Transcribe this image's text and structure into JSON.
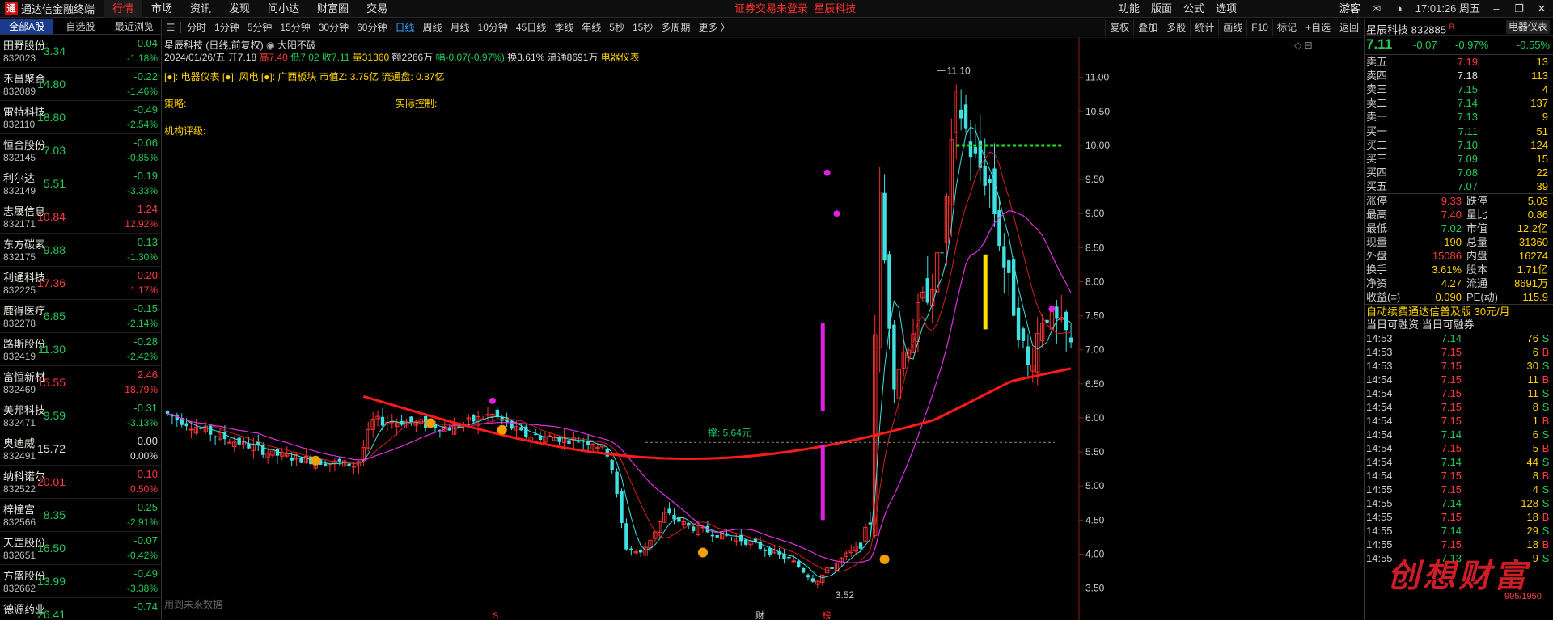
{
  "app": {
    "logo_mark": "通",
    "title": "通达信金融终端",
    "menu": [
      "行情",
      "市场",
      "资讯",
      "发现",
      "问小达",
      "财富圈",
      "交易"
    ],
    "notice": [
      "证券交易未登录",
      "星辰科技"
    ],
    "right_menu": [
      "功能",
      "版面",
      "公式",
      "选项"
    ],
    "user": "游客",
    "time": "17:01:26 周五"
  },
  "left_tabs": [
    "全部A股",
    "自选股",
    "最近浏览"
  ],
  "stocks": [
    {
      "name": "田野股份",
      "code": "832023",
      "price": "3.34",
      "chg": "-0.04",
      "pct": "-1.18%",
      "dir": "dn"
    },
    {
      "name": "禾昌聚合",
      "code": "832089",
      "price": "14.80",
      "chg": "-0.22",
      "pct": "-1.46%",
      "dir": "dn"
    },
    {
      "name": "雷特科技",
      "code": "832110",
      "price": "18.80",
      "chg": "-0.49",
      "pct": "-2.54%",
      "dir": "dn"
    },
    {
      "name": "恒合股份",
      "code": "832145",
      "price": "7.03",
      "chg": "-0.06",
      "pct": "-0.85%",
      "dir": "dn"
    },
    {
      "name": "利尔达",
      "code": "832149",
      "price": "5.51",
      "chg": "-0.19",
      "pct": "-3.33%",
      "dir": "dn"
    },
    {
      "name": "志晟信息",
      "code": "832171",
      "price": "10.84",
      "chg": "1.24",
      "pct": "12.92%",
      "dir": "up"
    },
    {
      "name": "东方碳素",
      "code": "832175",
      "price": "9.88",
      "chg": "-0.13",
      "pct": "-1.30%",
      "dir": "dn"
    },
    {
      "name": "利通科技",
      "code": "832225",
      "price": "17.36",
      "chg": "0.20",
      "pct": "1.17%",
      "dir": "up"
    },
    {
      "name": "鹿得医疗",
      "code": "832278",
      "price": "6.85",
      "chg": "-0.15",
      "pct": "-2.14%",
      "dir": "dn"
    },
    {
      "name": "路斯股份",
      "code": "832419",
      "price": "11.30",
      "chg": "-0.28",
      "pct": "-2.42%",
      "dir": "dn"
    },
    {
      "name": "富恒新材",
      "code": "832469",
      "price": "15.55",
      "chg": "2.46",
      "pct": "18.79%",
      "dir": "up"
    },
    {
      "name": "美邦科技",
      "code": "832471",
      "price": "9.59",
      "chg": "-0.31",
      "pct": "-3.13%",
      "dir": "dn"
    },
    {
      "name": "奥迪威",
      "code": "832491",
      "price": "15.72",
      "chg": "0.00",
      "pct": "0.00%",
      "dir": "flat"
    },
    {
      "name": "纳科诺尔",
      "code": "832522",
      "price": "20.01",
      "chg": "0.10",
      "pct": "0.50%",
      "dir": "up"
    },
    {
      "name": "梓橦宫",
      "code": "832566",
      "price": "8.35",
      "chg": "-0.25",
      "pct": "-2.91%",
      "dir": "dn"
    },
    {
      "name": "天罡股份",
      "code": "832651",
      "price": "16.50",
      "chg": "-0.07",
      "pct": "-0.42%",
      "dir": "dn"
    },
    {
      "name": "方盛股份",
      "code": "832662",
      "price": "13.99",
      "chg": "-0.49",
      "pct": "-3.38%",
      "dir": "dn"
    },
    {
      "name": "德源药业",
      "code": "",
      "price": "26.41",
      "chg": "-0.74",
      "pct": "",
      "dir": "dn"
    }
  ],
  "toolbar": {
    "periods": [
      "分时",
      "1分钟",
      "5分钟",
      "15分钟",
      "30分钟",
      "60分钟",
      "日线",
      "周线",
      "月线",
      "10分钟",
      "45日线",
      "季线",
      "年线",
      "5秒",
      "15秒",
      "多周期",
      "更多 〉"
    ],
    "active": "日线",
    "right": [
      "复权",
      "叠加",
      "多股",
      "统计",
      "画线",
      "F10",
      "标记",
      "+自选",
      "返回"
    ]
  },
  "chart_info": {
    "title": "星辰科技 (日线,前复权)",
    "pattern": "大阳不破",
    "date": "2024/01/26/五",
    "open_label": "开",
    "open": "7.18",
    "high_label": "高",
    "high": "7.40",
    "low_label": "低",
    "low": "7.02",
    "close_label": "收",
    "close": "7.11",
    "vol_label": "量",
    "vol": "31360",
    "amt_label": "额",
    "amt": "2266万",
    "range_label": "幅",
    "range": "-0.07(-0.97%)",
    "turnover_label": "换",
    "turnover": "3.61%",
    "float_label": "流通",
    "float": "8691万",
    "sector": "电器仪表",
    "line3": "[●]: 电器仪表 [●]: 风电  [●]: 广西板块  市值Z: 3.75亿  流通盘: 0.87亿",
    "strategy": "策略:",
    "control": "实际控制:",
    "rating": "机构评级:",
    "future": "用到未来数据",
    "annot_pressure": "撑: 5.64元",
    "label_max": "11.10",
    "label_min": "3.52",
    "marker_s": "S",
    "marker_cai": "财",
    "marker_bang": "榜"
  },
  "chart_data": {
    "type": "candlestick",
    "ylim": [
      3.4,
      11.4
    ],
    "yticks": [
      "3.50",
      "4.00",
      "4.50",
      "5.00",
      "5.50",
      "6.00",
      "6.50",
      "7.00",
      "7.50",
      "8.00",
      "8.50",
      "9.00",
      "9.50",
      "10.00",
      "10.50",
      "11.00"
    ],
    "high": 11.1,
    "low": 3.52,
    "last": 7.11,
    "support": 5.64
  },
  "right": {
    "title": "星辰科技 832885",
    "title_badge": "R",
    "button": "电器仪表",
    "price": "7.11",
    "change": "-0.07",
    "pct": "-0.97%",
    "sector_pct": "-0.55%",
    "asks": [
      {
        "l": "卖五",
        "p": "7.19",
        "v": "13"
      },
      {
        "l": "卖四",
        "p": "7.18",
        "v": "113"
      },
      {
        "l": "卖三",
        "p": "7.15",
        "v": "4"
      },
      {
        "l": "卖二",
        "p": "7.14",
        "v": "137"
      },
      {
        "l": "卖一",
        "p": "7.13",
        "v": "9"
      }
    ],
    "bids": [
      {
        "l": "买一",
        "p": "7.11",
        "v": "51"
      },
      {
        "l": "买二",
        "p": "7.10",
        "v": "124"
      },
      {
        "l": "买三",
        "p": "7.09",
        "v": "15"
      },
      {
        "l": "买四",
        "p": "7.08",
        "v": "22"
      },
      {
        "l": "买五",
        "p": "7.07",
        "v": "39"
      }
    ],
    "stats": [
      {
        "a": "涨停",
        "b": "9.33",
        "bc": "up",
        "c": "跌停",
        "d": "5.03",
        "dc": "dn"
      },
      {
        "a": "最高",
        "b": "7.40",
        "bc": "up",
        "c": "量比",
        "d": "0.86",
        "dc": "y"
      },
      {
        "a": "最低",
        "b": "7.02",
        "bc": "dn",
        "c": "市值",
        "d": "12.2亿",
        "dc": "y"
      },
      {
        "a": "现量",
        "b": "190",
        "bc": "y",
        "c": "总量",
        "d": "31360",
        "dc": "y"
      },
      {
        "a": "外盘",
        "b": "15086",
        "bc": "up",
        "c": "内盘",
        "d": "16274",
        "dc": "dn"
      },
      {
        "a": "换手",
        "b": "3.61%",
        "bc": "y",
        "c": "股本",
        "d": "1.71亿",
        "dc": "y"
      },
      {
        "a": "净资",
        "b": "4.27",
        "bc": "y",
        "c": "流通",
        "d": "8691万",
        "dc": "y"
      },
      {
        "a": "收益(≡)",
        "b": "0.090",
        "bc": "y",
        "c": "PE(动)",
        "d": "115.9",
        "dc": "y"
      }
    ],
    "margin_line": "自动续费通达信普及版  30元/月",
    "margin_line2": "当日可融资  当日可融券",
    "ticks": [
      {
        "t": "14:53",
        "p": "7.14",
        "v": "76",
        "s": "S"
      },
      {
        "t": "14:53",
        "p": "7.15",
        "v": "6",
        "s": "B"
      },
      {
        "t": "14:53",
        "p": "7.15",
        "v": "30",
        "s": "S"
      },
      {
        "t": "14:54",
        "p": "7.15",
        "v": "11",
        "s": "B"
      },
      {
        "t": "14:54",
        "p": "7.15",
        "v": "11",
        "s": "S"
      },
      {
        "t": "14:54",
        "p": "7.15",
        "v": "8",
        "s": "S"
      },
      {
        "t": "14:54",
        "p": "7.15",
        "v": "1",
        "s": "B"
      },
      {
        "t": "14:54",
        "p": "7.14",
        "v": "6",
        "s": "S"
      },
      {
        "t": "14:54",
        "p": "7.15",
        "v": "5",
        "s": "B"
      },
      {
        "t": "14:54",
        "p": "7.14",
        "v": "44",
        "s": "S"
      },
      {
        "t": "14:54",
        "p": "7.15",
        "v": "8",
        "s": "B"
      },
      {
        "t": "14:55",
        "p": "7.15",
        "v": "4",
        "s": "S"
      },
      {
        "t": "14:55",
        "p": "7.14",
        "v": "128",
        "s": "S"
      },
      {
        "t": "14:55",
        "p": "7.15",
        "v": "18",
        "s": "B"
      },
      {
        "t": "14:55",
        "p": "7.14",
        "v": "29",
        "s": "S"
      },
      {
        "t": "14:55",
        "p": "7.15",
        "v": "18",
        "s": "B"
      },
      {
        "t": "14:55",
        "p": "7.13",
        "v": "9",
        "s": "S"
      }
    ],
    "watermark": "创想财富",
    "watermark_sub": "995/1950"
  }
}
